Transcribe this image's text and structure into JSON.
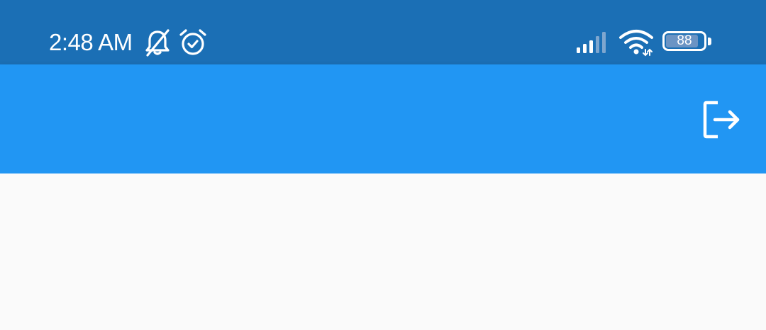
{
  "status_bar": {
    "time": "2:48 AM",
    "icons": [
      "bell-off-icon",
      "alarm-icon",
      "signal-icon",
      "wifi-icon",
      "battery-icon"
    ],
    "battery_level": "88",
    "background_color": "#1b6fb5"
  },
  "app_bar": {
    "background_color": "#2196f3",
    "actions": [
      {
        "name": "logout",
        "icon": "logout-icon"
      }
    ]
  },
  "content": {
    "background_color": "#fafafa"
  }
}
